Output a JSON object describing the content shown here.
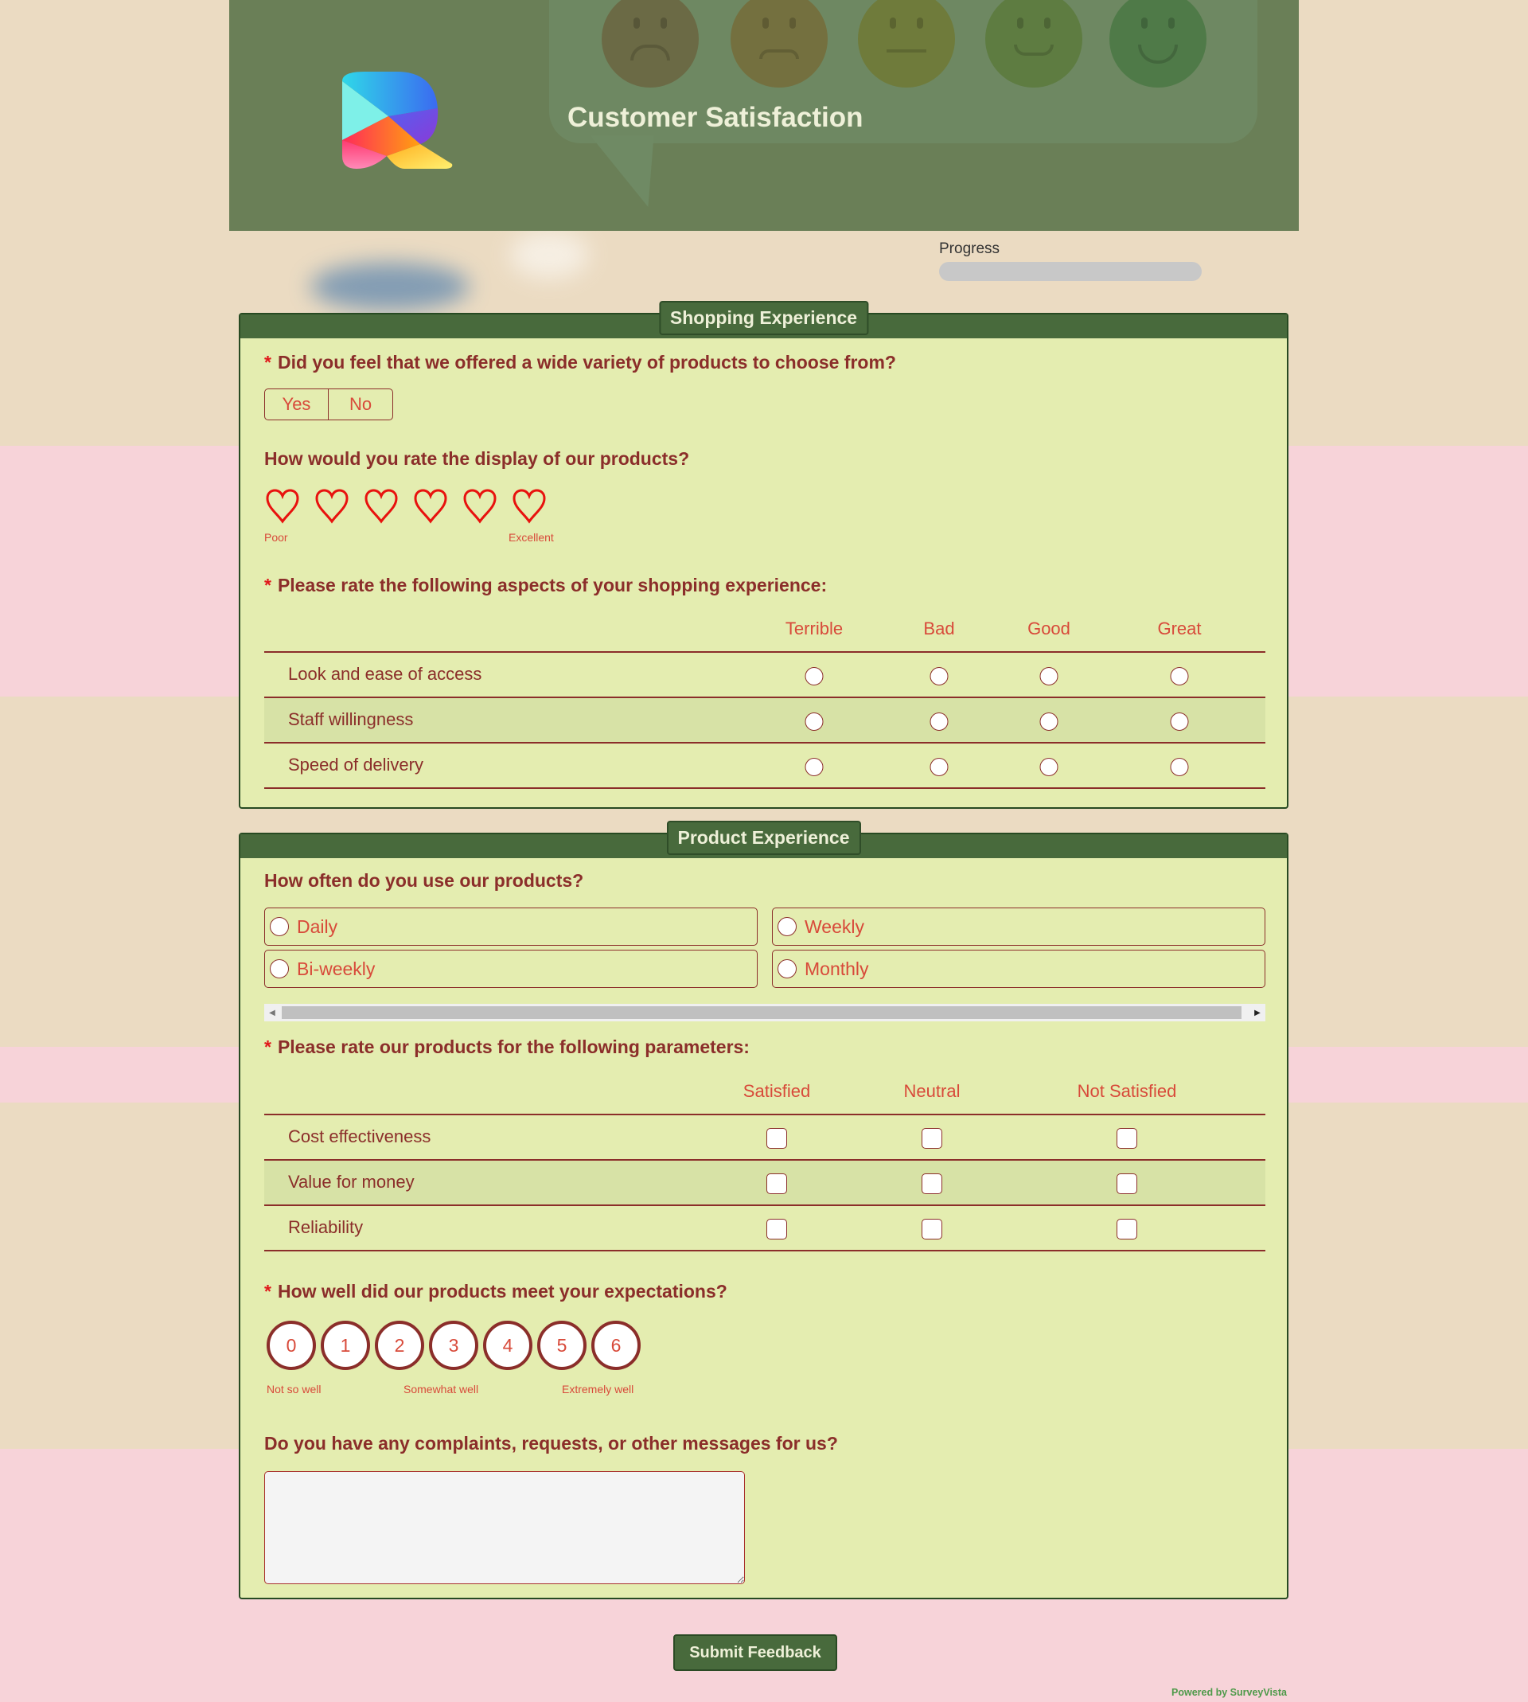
{
  "colors": {
    "header_bg": "#6a7f57",
    "section_header": "#486a3c",
    "panel_bg": "#e4edb0",
    "question_text": "#8b2e2a",
    "option_text": "#d84a3a",
    "required_star": "#e0181b",
    "heart": "#e8120e",
    "powered_by": "#4e9a4a"
  },
  "header": {
    "logo_icon": "gradient-r-logo",
    "title": "Customer Satisfaction",
    "decoration_icons": [
      "very-sad-face-icon",
      "sad-face-icon",
      "neutral-face-icon",
      "happy-face-icon",
      "very-happy-face-icon"
    ]
  },
  "progress": {
    "label": "Progress",
    "percent": 0
  },
  "sections": [
    {
      "title": "Shopping Experience",
      "questions": {
        "variety": {
          "required_mark": "*",
          "title": "Did you feel that we offered a wide variety of products to choose from?",
          "options": [
            "Yes",
            "No"
          ]
        },
        "display": {
          "title": "How would you rate the display of our products?",
          "icon": "heart-icon",
          "scale_count": 6,
          "min_label": "Poor",
          "max_label": "Excellent"
        },
        "aspects": {
          "required_mark": "*",
          "title": "Please rate the following aspects of your shopping experience:",
          "columns": [
            "Terrible",
            "Bad",
            "Good",
            "Great"
          ],
          "rows": [
            "Look and ease of access",
            "Staff willingness",
            "Speed of delivery"
          ]
        }
      }
    },
    {
      "title": "Product Experience",
      "questions": {
        "frequency": {
          "title": "How often do you use our products?",
          "options": [
            "Daily",
            "Weekly",
            "Bi-weekly",
            "Monthly"
          ]
        },
        "parameters": {
          "required_mark": "*",
          "title": "Please rate our products for the following parameters:",
          "columns": [
            "Satisfied",
            "Neutral",
            "Not Satisfied"
          ],
          "rows": [
            "Cost effectiveness",
            "Value for money",
            "Reliability"
          ]
        },
        "expectations": {
          "required_mark": "*",
          "title": "How well did our products meet your expectations?",
          "scale": [
            "0",
            "1",
            "2",
            "3",
            "4",
            "5",
            "6"
          ],
          "labels": [
            "Not so well",
            "Somewhat well",
            "Extremely well"
          ]
        },
        "messages": {
          "title": "Do you have any complaints, requests, or other messages for us?",
          "value": "",
          "placeholder": ""
        }
      }
    }
  ],
  "submit_label": "Submit Feedback",
  "powered_by": "Powered by SurveyVista"
}
